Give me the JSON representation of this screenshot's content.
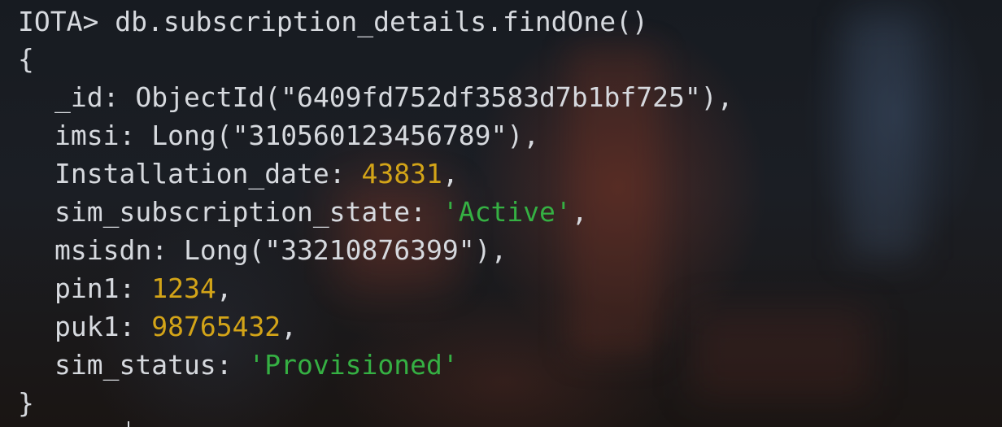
{
  "prompt": "IOTA>",
  "command": "db.subscription_details.findOne()",
  "open_brace": "{",
  "close_brace": "}",
  "fields": [
    {
      "key": "_id",
      "prefix": "ObjectId(\"",
      "value": "6409fd752df3583d7b1bf725",
      "suffix": "\"),"
    },
    {
      "key": "imsi",
      "prefix": "Long(\"",
      "value": "310560123456789",
      "suffix": "\"),"
    },
    {
      "key": "Installation_date",
      "value": "43831",
      "suffix": ","
    },
    {
      "key": "sim_subscription_state",
      "value": "'Active'",
      "suffix": ","
    },
    {
      "key": "msisdn",
      "prefix": "Long(\"",
      "value": "33210876399",
      "suffix": "\"),"
    },
    {
      "key": "pin1",
      "value": "1234",
      "suffix": ","
    },
    {
      "key": "puk1",
      "value": "98765432",
      "suffix": ","
    },
    {
      "key": "sim_status",
      "value": "'Provisioned'",
      "suffix": ""
    }
  ],
  "colors": {
    "text": "#d6d9de",
    "number": "#d3a418",
    "string": "#35b043"
  }
}
